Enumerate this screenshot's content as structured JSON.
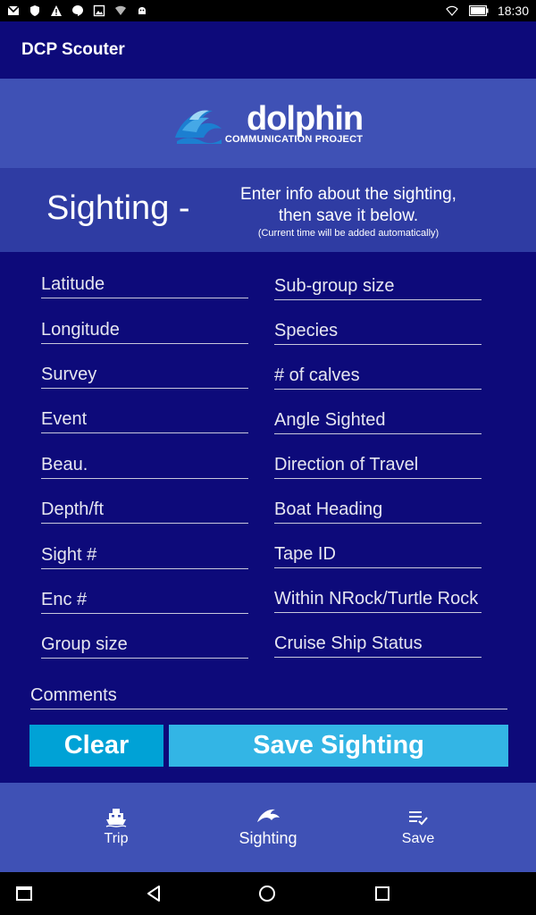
{
  "status_bar": {
    "time": "18:30"
  },
  "app": {
    "title": "DCP Scouter"
  },
  "logo": {
    "name": "dolphin",
    "subtitle": "COMMUNICATION PROJECT"
  },
  "sighting_header": {
    "title": "Sighting -",
    "hint_line1": "Enter info about the sighting,",
    "hint_line2": "then save it below.",
    "hint_small": "(Current time will be added automatically)"
  },
  "form": {
    "left": [
      "Latitude",
      "Longitude",
      "Survey",
      "Event",
      "Beau.",
      "Depth/ft",
      "Sight #",
      "Enc #",
      "Group size"
    ],
    "right": [
      "Sub-group size",
      "Species",
      "# of calves",
      "Angle Sighted",
      "Direction of Travel",
      "Boat Heading",
      "Tape ID",
      "Within NRock/Turtle Rock",
      "Cruise Ship Status"
    ],
    "comments": "Comments"
  },
  "buttons": {
    "clear": "Clear",
    "save": "Save Sighting"
  },
  "bottom_nav": {
    "trip": "Trip",
    "sighting": "Sighting",
    "save": "Save"
  },
  "colors": {
    "background": "#0d0a7a",
    "band": "#3f51b5",
    "clear_button": "#00a2d6",
    "save_button": "#33b5e5"
  }
}
